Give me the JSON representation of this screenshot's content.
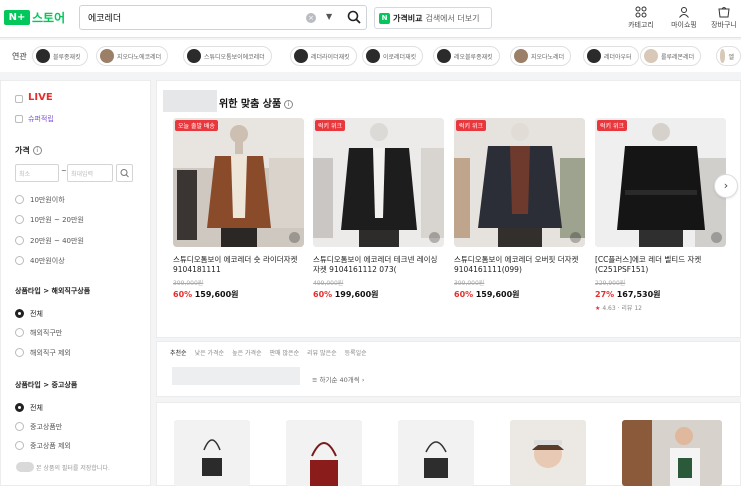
{
  "header": {
    "logo_n": "N+",
    "logo_text": "스토어",
    "search_value": "에코레더",
    "clear": "×",
    "dropdown": "▼",
    "compare_label": "가격비교",
    "compare_rest": "검색에서 더보기",
    "icons": [
      {
        "name": "category-icon",
        "label": "카테고리"
      },
      {
        "name": "mypage-icon",
        "label": "마이쇼핑"
      },
      {
        "name": "cart-icon",
        "label": "장바구니"
      }
    ]
  },
  "categories": {
    "label": "연관",
    "chips": [
      "블루종재킷",
      "지오다노에코레더",
      "스튜디오톰보이에코레더",
      "레더라이더재킷",
      "이로레더재킷",
      "레오블루종재킷",
      "지오다노레더",
      "레더아우터",
      "룰루레몬레더",
      "엘"
    ]
  },
  "sidebar": {
    "live": "LIVE",
    "checkbox2": "슈퍼적립",
    "price_title": "가격",
    "price_min": "최소",
    "price_max": "최대입력",
    "price_ranges": [
      "10만원이하",
      "10만원 ~ 20만원",
      "20만원 ~ 40만원",
      "40만원이상"
    ],
    "seller_title": "상품타입 > 해외직구상품",
    "seller_opts": [
      "전체",
      "해외직구만",
      "해외직구 제외"
    ],
    "ad_title": "상품타입 > 중고상품",
    "ad_opts": [
      "전체",
      "중고상품만",
      "중고상품 제외"
    ],
    "toggle_text": "본 상품의 필터를 저장합니다."
  },
  "recommend": {
    "title": "위한 맞춤 상품",
    "info": "i",
    "next": "›",
    "cards": [
      {
        "badge": "오늘 출발 배송",
        "name": "스튜디오톰보이 에코레더 숏 라이더자켓 9104181111",
        "old": "399,000원",
        "pct": "60%",
        "price": "159,600원",
        "rev": ""
      },
      {
        "badge": "럭키 위크",
        "name": "스튜디오톰보이 에코레더 테크넨 레이싱자켓 9104161112 073(",
        "old": "499,000원",
        "pct": "60%",
        "price": "199,600원",
        "rev": ""
      },
      {
        "badge": "럭키 위크",
        "name": "스튜디오톰보이 에코레더 오버핏 더자켓 9104161111(099)",
        "old": "399,000원",
        "pct": "60%",
        "price": "159,600원",
        "rev": ""
      },
      {
        "badge": "럭키 위크",
        "name": "[CC플러스]에코 레더 벨티드 자켓(C251PSF151)",
        "old": "229,900원",
        "pct": "27%",
        "price": "167,530원",
        "star": "★",
        "rating": "4.63",
        "rev": "리뷰 12"
      }
    ]
  },
  "sort": {
    "items": [
      "추천순",
      "낮은 가격순",
      "높은 가격순",
      "판매 많은순",
      "리뷰 많은순",
      "등록일순"
    ],
    "list_count": "≡ 하기순   40개씩 ›"
  }
}
